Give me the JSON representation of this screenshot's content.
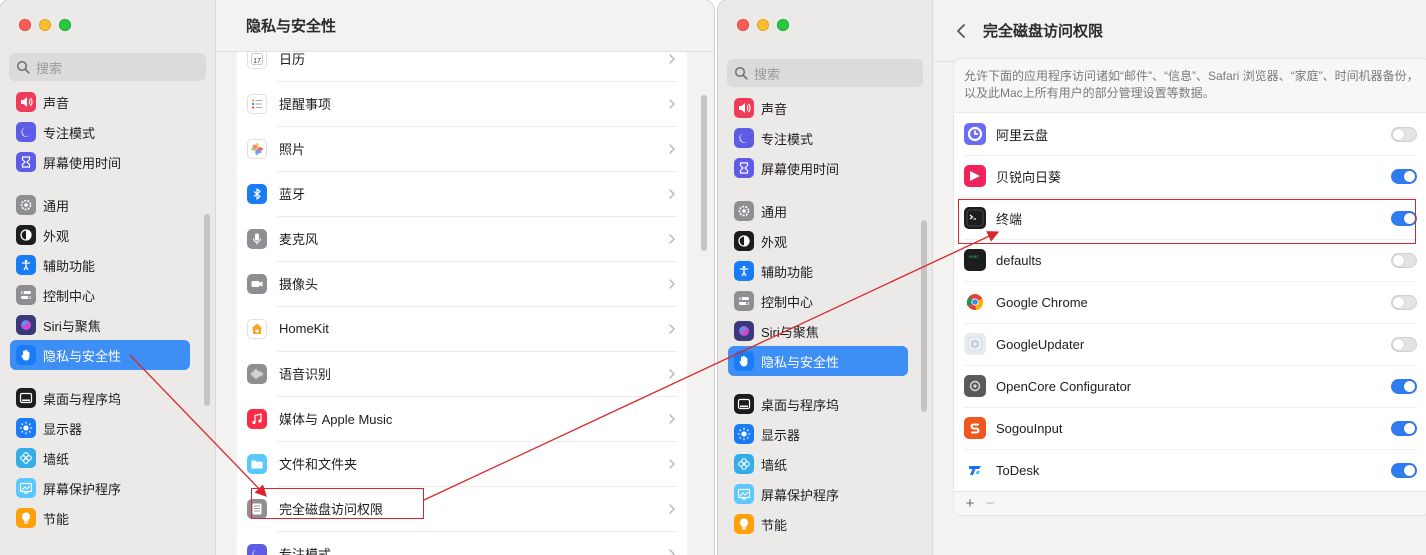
{
  "left_window": {
    "title": "隐私与安全性",
    "search_placeholder": "搜索",
    "sidebar": [
      {
        "label": "声音",
        "icon": "speaker-icon",
        "color": "#f03c5a",
        "selected": false
      },
      {
        "label": "专注模式",
        "icon": "moon-icon",
        "color": "#5e5ce6",
        "selected": false
      },
      {
        "label": "屏幕使用时间",
        "icon": "hourglass-icon",
        "color": "#5e5ce6",
        "selected": false
      },
      {
        "gap": true
      },
      {
        "label": "通用",
        "icon": "gear-icon",
        "color": "#8e8e93",
        "selected": false
      },
      {
        "label": "外观",
        "icon": "appearance-icon",
        "color": "#1d1d1f",
        "selected": false
      },
      {
        "label": "辅助功能",
        "icon": "accessibility-icon",
        "color": "#1a7cf5",
        "selected": false
      },
      {
        "label": "控制中心",
        "icon": "toggles-icon",
        "color": "#8e8e93",
        "selected": false
      },
      {
        "label": "Siri与聚焦",
        "icon": "siri-icon",
        "color": "#3a3a7a",
        "selected": false
      },
      {
        "label": "隐私与安全性",
        "icon": "hand-icon",
        "color": "#1a7cf5",
        "selected": true
      },
      {
        "gap": true
      },
      {
        "label": "桌面与程序坞",
        "icon": "dock-icon",
        "color": "#1d1d1f",
        "selected": false
      },
      {
        "label": "显示器",
        "icon": "sun-icon",
        "color": "#1a7cf5",
        "selected": false
      },
      {
        "label": "墙纸",
        "icon": "flower-icon",
        "color": "#32ade6",
        "selected": false
      },
      {
        "label": "屏幕保护程序",
        "icon": "screensaver-icon",
        "color": "#5ac8fa",
        "selected": false
      },
      {
        "label": "节能",
        "icon": "bulb-icon",
        "color": "#ff9f0a",
        "selected": false
      }
    ],
    "list": [
      {
        "label": "日历",
        "icon": "calendar-icon",
        "color": "#ffffff"
      },
      {
        "label": "提醒事项",
        "icon": "reminders-icon",
        "color": "#ffffff"
      },
      {
        "label": "照片",
        "icon": "photos-icon",
        "color": "#ffffff"
      },
      {
        "label": "蓝牙",
        "icon": "bluetooth-icon",
        "color": "#1a7cf5"
      },
      {
        "label": "麦克风",
        "icon": "microphone-icon",
        "color": "#8e8e93"
      },
      {
        "label": "摄像头",
        "icon": "camera-icon",
        "color": "#8e8e93"
      },
      {
        "label": "HomeKit",
        "icon": "home-icon",
        "color": "#ffffff"
      },
      {
        "label": "语音识别",
        "icon": "waveform-icon",
        "color": "#8e8e93"
      },
      {
        "label": "媒体与 Apple Music",
        "icon": "music-icon",
        "color": "#fa2d48"
      },
      {
        "label": "文件和文件夹",
        "icon": "folder-icon",
        "color": "#5ac8fa"
      },
      {
        "label": "完全磁盘访问权限",
        "icon": "disk-icon",
        "color": "#8e8e93"
      },
      {
        "label": "专注模式",
        "icon": "moon-icon",
        "color": "#5e5ce6"
      }
    ]
  },
  "right_window": {
    "title": "完全磁盘访问权限",
    "search_placeholder": "搜索",
    "description": "允许下面的应用程序访问诸如“邮件”、“信息”、Safari 浏览器、“家庭”、时间机器备份，以及此Mac上所有用户的部分管理设置等数据。",
    "sidebar": [
      {
        "label": "声音",
        "icon": "speaker-icon",
        "color": "#f03c5a",
        "selected": false
      },
      {
        "label": "专注模式",
        "icon": "moon-icon",
        "color": "#5e5ce6",
        "selected": false
      },
      {
        "label": "屏幕使用时间",
        "icon": "hourglass-icon",
        "color": "#5e5ce6",
        "selected": false
      },
      {
        "gap": true
      },
      {
        "label": "通用",
        "icon": "gear-icon",
        "color": "#8e8e93",
        "selected": false
      },
      {
        "label": "外观",
        "icon": "appearance-icon",
        "color": "#1d1d1f",
        "selected": false
      },
      {
        "label": "辅助功能",
        "icon": "accessibility-icon",
        "color": "#1a7cf5",
        "selected": false
      },
      {
        "label": "控制中心",
        "icon": "toggles-icon",
        "color": "#8e8e93",
        "selected": false
      },
      {
        "label": "Siri与聚焦",
        "icon": "siri-icon",
        "color": "#3a3a7a",
        "selected": false
      },
      {
        "label": "隐私与安全性",
        "icon": "hand-icon",
        "color": "#1a7cf5",
        "selected": true
      },
      {
        "gap": true
      },
      {
        "label": "桌面与程序坞",
        "icon": "dock-icon",
        "color": "#1d1d1f",
        "selected": false
      },
      {
        "label": "显示器",
        "icon": "sun-icon",
        "color": "#1a7cf5",
        "selected": false
      },
      {
        "label": "墙纸",
        "icon": "flower-icon",
        "color": "#32ade6",
        "selected": false
      },
      {
        "label": "屏幕保护程序",
        "icon": "screensaver-icon",
        "color": "#5ac8fa",
        "selected": false
      },
      {
        "label": "节能",
        "icon": "bulb-icon",
        "color": "#ff9f0a",
        "selected": false
      }
    ],
    "apps": [
      {
        "name": "阿里云盘",
        "icon": "aliyundrive-icon",
        "color": "#6b6bf5",
        "enabled": false
      },
      {
        "name": "贝锐向日葵",
        "icon": "sunlogin-icon",
        "color": "#f0245c",
        "enabled": true
      },
      {
        "name": "终端",
        "icon": "terminal-icon",
        "color": "#1d1d1f",
        "enabled": true
      },
      {
        "name": "defaults",
        "icon": "exec-icon",
        "color": "#1d1d1f",
        "enabled": false
      },
      {
        "name": "Google Chrome",
        "icon": "chrome-icon",
        "color": "#ffffff",
        "enabled": false
      },
      {
        "name": "GoogleUpdater",
        "icon": "updater-icon",
        "color": "#e8edf2",
        "enabled": false
      },
      {
        "name": "OpenCore Configurator",
        "icon": "opencore-icon",
        "color": "#5a5a5a",
        "enabled": true
      },
      {
        "name": "SogouInput",
        "icon": "sogou-icon",
        "color": "#f0571f",
        "enabled": true
      },
      {
        "name": "ToDesk",
        "icon": "todesk-icon",
        "color": "#ffffff",
        "enabled": true
      }
    ],
    "add_label": "+",
    "remove_label": "−"
  },
  "colors": {
    "accent": "#3e8ff5",
    "annotation": "#d9262c"
  }
}
